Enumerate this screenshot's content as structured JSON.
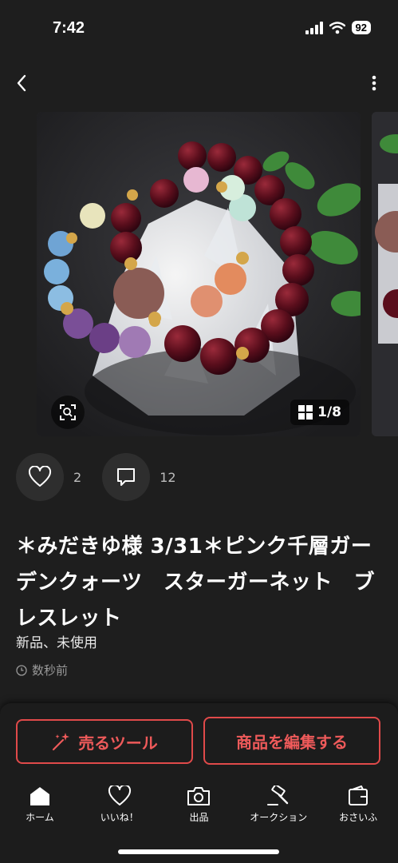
{
  "status": {
    "time": "7:42",
    "battery": "92"
  },
  "gallery": {
    "counter": "1/8"
  },
  "actions": {
    "likes": "2",
    "comments": "12"
  },
  "item": {
    "title": "＊みだきゆ様 3/31＊ピンク千層ガーデンクォーツ　スターガーネット　ブレスレット",
    "condition": "新品、未使用",
    "posted": "数秒前"
  },
  "buttons": {
    "sell_tool": "売るツール",
    "edit_item": "商品を編集する"
  },
  "tabs": [
    {
      "label": "ホーム",
      "icon": "home-icon"
    },
    {
      "label": "いいね！",
      "icon": "heart-icon"
    },
    {
      "label": "出品",
      "icon": "camera-icon"
    },
    {
      "label": "オークション",
      "icon": "gavel-icon"
    },
    {
      "label": "おさいふ",
      "icon": "wallet-icon"
    }
  ],
  "colors": {
    "background": "#1e1e1e",
    "accent": "#ee5a5a"
  }
}
